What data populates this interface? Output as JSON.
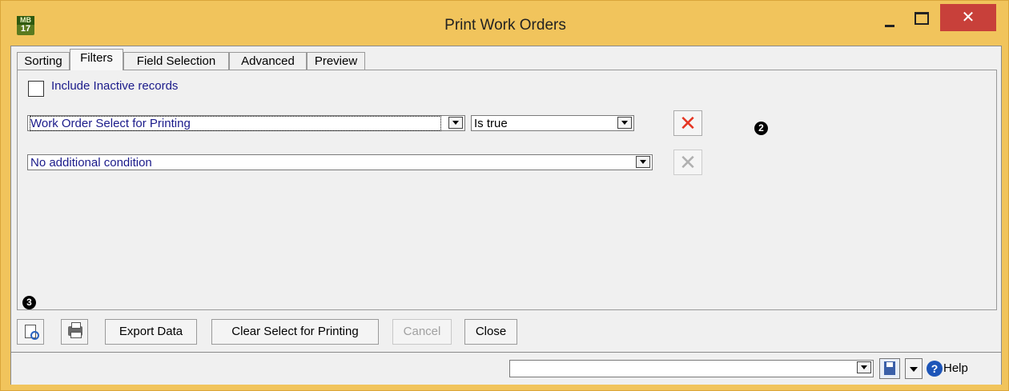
{
  "window": {
    "title": "Print Work Orders",
    "app_icon_top": "MB",
    "app_icon_bottom": "17",
    "close_glyph": "✕",
    "colors": {
      "frame": "#f1c45c",
      "close": "#c8403a",
      "accent_text": "#1a1a8a"
    }
  },
  "tabs": [
    {
      "label": "Sorting",
      "active": false
    },
    {
      "label": "Filters",
      "active": true
    },
    {
      "label": "Field Selection",
      "active": false
    },
    {
      "label": "Advanced",
      "active": false
    },
    {
      "label": "Preview",
      "active": false
    }
  ],
  "filters": {
    "include_inactive_label": "Include Inactive records",
    "include_inactive_checked": false,
    "condition1_field": "Work Order Select for Printing",
    "condition1_operator": "Is true",
    "condition2_field": "No additional condition",
    "remove_glyph": "✕"
  },
  "annotations": {
    "marker2": "2",
    "marker3": "3"
  },
  "toolbar": {
    "preview_icon": "print-preview-icon",
    "print_icon": "printer-icon",
    "export_label": "Export Data",
    "clear_label": "Clear Select for Printing",
    "cancel_label": "Cancel",
    "cancel_enabled": false,
    "close_label": "Close"
  },
  "statusbar": {
    "combo_value": "",
    "save_icon": "save-icon",
    "help_glyph": "?",
    "help_label": "Help"
  }
}
